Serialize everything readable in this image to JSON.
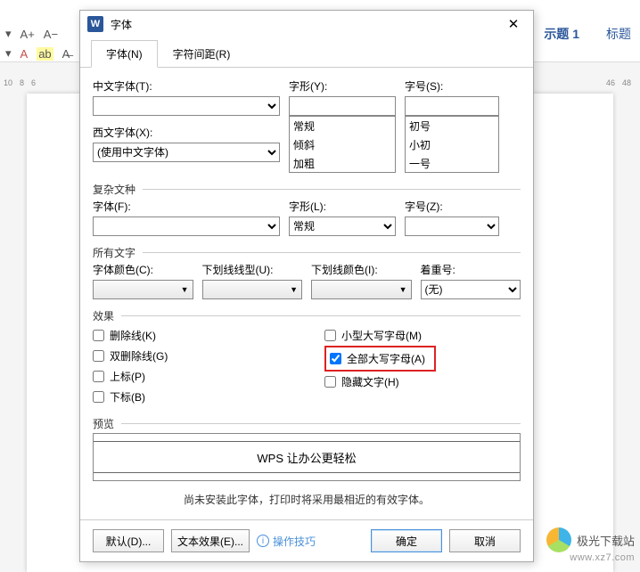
{
  "titlebar": {
    "icon_text": "W",
    "title": "字体",
    "close": "✕"
  },
  "tabs": {
    "font": "字体(N)",
    "spacing": "字符间距(R)"
  },
  "top": {
    "chinese_font_label": "中文字体(T):",
    "western_font_label": "西文字体(X):",
    "western_font_value": "(使用中文字体)",
    "style_label": "字形(Y):",
    "style_options": [
      "常规",
      "倾斜",
      "加粗"
    ],
    "size_label": "字号(S):",
    "size_options": [
      "初号",
      "小初",
      "一号"
    ]
  },
  "complex": {
    "legend": "复杂文种",
    "font_label": "字体(F):",
    "style_label": "字形(L):",
    "style_value": "常规",
    "size_label": "字号(Z):"
  },
  "allfonts": {
    "legend": "所有文字",
    "color_label": "字体颜色(C):",
    "underline_style_label": "下划线线型(U):",
    "underline_color_label": "下划线颜色(I):",
    "emphasis_label": "着重号:",
    "emphasis_value": "(无)"
  },
  "effects": {
    "legend": "效果",
    "strike": "删除线(K)",
    "dstrike": "双删除线(G)",
    "super": "上标(P)",
    "sub": "下标(B)",
    "smallcaps": "小型大写字母(M)",
    "allcaps": "全部大写字母(A)",
    "hidden": "隐藏文字(H)"
  },
  "preview": {
    "legend": "预览",
    "sample": "WPS 让办公更轻松",
    "hint": "尚未安装此字体，打印时将采用最相近的有效字体。"
  },
  "footer": {
    "default": "默认(D)...",
    "text_effect": "文本效果(E)...",
    "tips": "操作技巧",
    "ok": "确定",
    "cancel": "取消"
  },
  "bg": {
    "heading1": "示题 1",
    "heading2": "标题",
    "ruler_left": [
      "10",
      "8",
      "6"
    ],
    "ruler_right": [
      "46",
      "48"
    ],
    "aplus": "A+",
    "aminus": "A−"
  },
  "watermark": {
    "text": "极光下载站",
    "url": "www.xz7.com"
  }
}
